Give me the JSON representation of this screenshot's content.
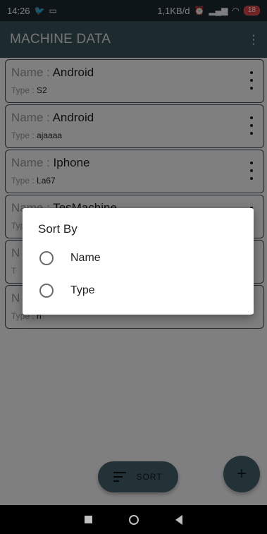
{
  "status_bar": {
    "time": "14:26",
    "network_speed": "1,1KB/d",
    "battery": "18",
    "icons": [
      "twitter-icon",
      "screen-cast-icon",
      "alarm-icon",
      "signal-icon",
      "wifi-icon"
    ]
  },
  "app_bar": {
    "title": "MACHINE DATA",
    "overflow_icon": "more-vert-icon"
  },
  "machines": [
    {
      "name_label": "Name : ",
      "name": "Android",
      "type_label": "Type : ",
      "type": "S2"
    },
    {
      "name_label": "Name : ",
      "name": "Android",
      "type_label": "Type : ",
      "type": "ajaaaa"
    },
    {
      "name_label": "Name : ",
      "name": "Iphone",
      "type_label": "Type : ",
      "type": "La67"
    },
    {
      "name_label": "Name : ",
      "name": "TesMachine",
      "type_label": "Type : ",
      "type": ""
    },
    {
      "name_label": "N",
      "name": "",
      "type_label": "T",
      "type": ""
    },
    {
      "name_label": "N",
      "name": "",
      "type_label": "Type : ",
      "type": "n"
    }
  ],
  "dialog": {
    "title": "Sort By",
    "options": [
      {
        "label": "Name",
        "selected": false
      },
      {
        "label": "Type",
        "selected": false
      }
    ]
  },
  "sort_button": {
    "label": "SORT",
    "icon": "sort-icon"
  },
  "add_button": {
    "icon": "add-icon",
    "symbol": "+"
  },
  "colors": {
    "status_bar": "#1d2a31",
    "app_bar": "#3a565e",
    "fab": "#47656c",
    "card_border": "#3e4f55"
  }
}
